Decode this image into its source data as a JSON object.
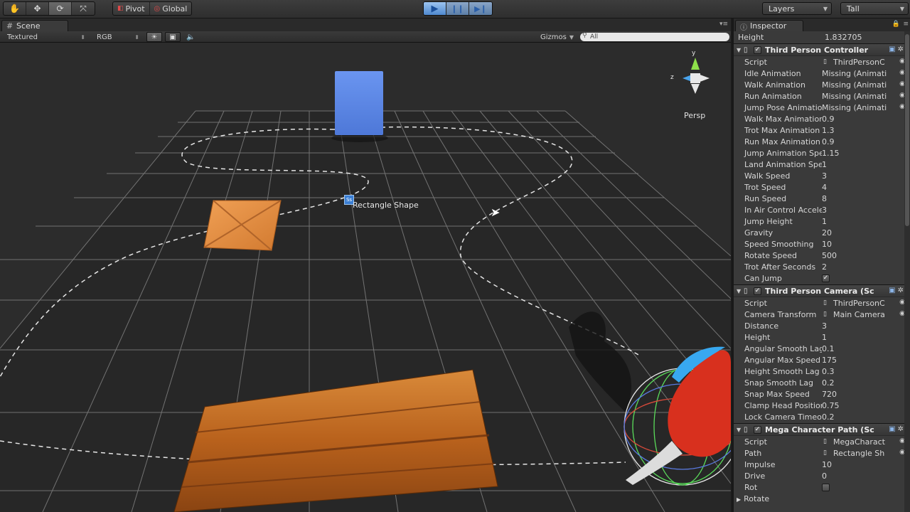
{
  "toolbar": {
    "pivot": "Pivot",
    "global": "Global",
    "layers": "Layers",
    "layout": "Tall",
    "icons": {
      "hand": "hand-icon",
      "move": "move-icon",
      "rotate": "rotate-icon",
      "scale": "scale-icon",
      "play": "play-icon",
      "pause": "pause-icon",
      "step": "step-icon"
    }
  },
  "scene": {
    "tab": "Scene",
    "render_mode": "Textured",
    "color_mode": "RGB",
    "gizmos": "Gizmos",
    "search": "All",
    "persp": "Persp",
    "object_label": "Rectangle Shape",
    "axis_y": "y",
    "axis_z": "z"
  },
  "inspector": {
    "tab": "Inspector",
    "top_row": {
      "label": "Height",
      "value": "1.832705"
    },
    "components": [
      {
        "title": "Third Person Controller",
        "fields": [
          {
            "label": "Script",
            "value": "ThirdPersonC",
            "kind": "object"
          },
          {
            "label": "Idle Animation",
            "value": "Missing (Animati",
            "kind": "field"
          },
          {
            "label": "Walk Animation",
            "value": "Missing (Animati",
            "kind": "field"
          },
          {
            "label": "Run Animation",
            "value": "Missing (Animati",
            "kind": "field"
          },
          {
            "label": "Jump Pose Animation",
            "value": "Missing (Animati",
            "kind": "field"
          },
          {
            "label": "Walk Max Animation",
            "value": "0.9",
            "kind": "text"
          },
          {
            "label": "Trot Max Animation S",
            "value": "1.3",
            "kind": "text"
          },
          {
            "label": "Run Max Animation S",
            "value": "0.9",
            "kind": "text"
          },
          {
            "label": "Jump Animation Spee",
            "value": "1.15",
            "kind": "text"
          },
          {
            "label": "Land Animation Spee",
            "value": "1",
            "kind": "text"
          },
          {
            "label": "Walk Speed",
            "value": "3",
            "kind": "text"
          },
          {
            "label": "Trot Speed",
            "value": "4",
            "kind": "text"
          },
          {
            "label": "Run Speed",
            "value": "8",
            "kind": "text"
          },
          {
            "label": "In Air Control Accele",
            "value": "3",
            "kind": "text"
          },
          {
            "label": "Jump Height",
            "value": "1",
            "kind": "text"
          },
          {
            "label": "Gravity",
            "value": "20",
            "kind": "text"
          },
          {
            "label": "Speed Smoothing",
            "value": "10",
            "kind": "text"
          },
          {
            "label": "Rotate Speed",
            "value": "500",
            "kind": "text"
          },
          {
            "label": "Trot After Seconds",
            "value": "2",
            "kind": "text"
          },
          {
            "label": "Can Jump",
            "value": "",
            "kind": "check",
            "checked": true
          }
        ]
      },
      {
        "title": "Third Person Camera (Sc",
        "fields": [
          {
            "label": "Script",
            "value": "ThirdPersonC",
            "kind": "object"
          },
          {
            "label": "Camera Transform",
            "value": "Main Camera",
            "kind": "object"
          },
          {
            "label": "Distance",
            "value": "3",
            "kind": "text"
          },
          {
            "label": "Height",
            "value": "1",
            "kind": "text"
          },
          {
            "label": "Angular Smooth Lag",
            "value": "0.1",
            "kind": "text"
          },
          {
            "label": "Angular Max Speed",
            "value": "175",
            "kind": "text"
          },
          {
            "label": "Height Smooth Lag",
            "value": "0.3",
            "kind": "text"
          },
          {
            "label": "Snap Smooth Lag",
            "value": "0.2",
            "kind": "text"
          },
          {
            "label": "Snap Max Speed",
            "value": "720",
            "kind": "text"
          },
          {
            "label": "Clamp Head Position",
            "value": "0.75",
            "kind": "text"
          },
          {
            "label": "Lock Camera Timeou",
            "value": "0.2",
            "kind": "text"
          }
        ]
      },
      {
        "title": "Mega Character Path (Sc",
        "fields": [
          {
            "label": "Script",
            "value": "MegaCharact",
            "kind": "object"
          },
          {
            "label": "Path",
            "value": "Rectangle Sh",
            "kind": "object"
          },
          {
            "label": "Impulse",
            "value": "10",
            "kind": "text"
          },
          {
            "label": "Drive",
            "value": "0",
            "kind": "text"
          },
          {
            "label": "Rot",
            "value": "",
            "kind": "check",
            "checked": false
          }
        ],
        "foldout": "Rotate"
      }
    ]
  },
  "colors": {
    "blue_cube": "#5b86e8",
    "crate": "#e08a3c",
    "ramp": "#c06a22",
    "robot": "#d8301e"
  }
}
